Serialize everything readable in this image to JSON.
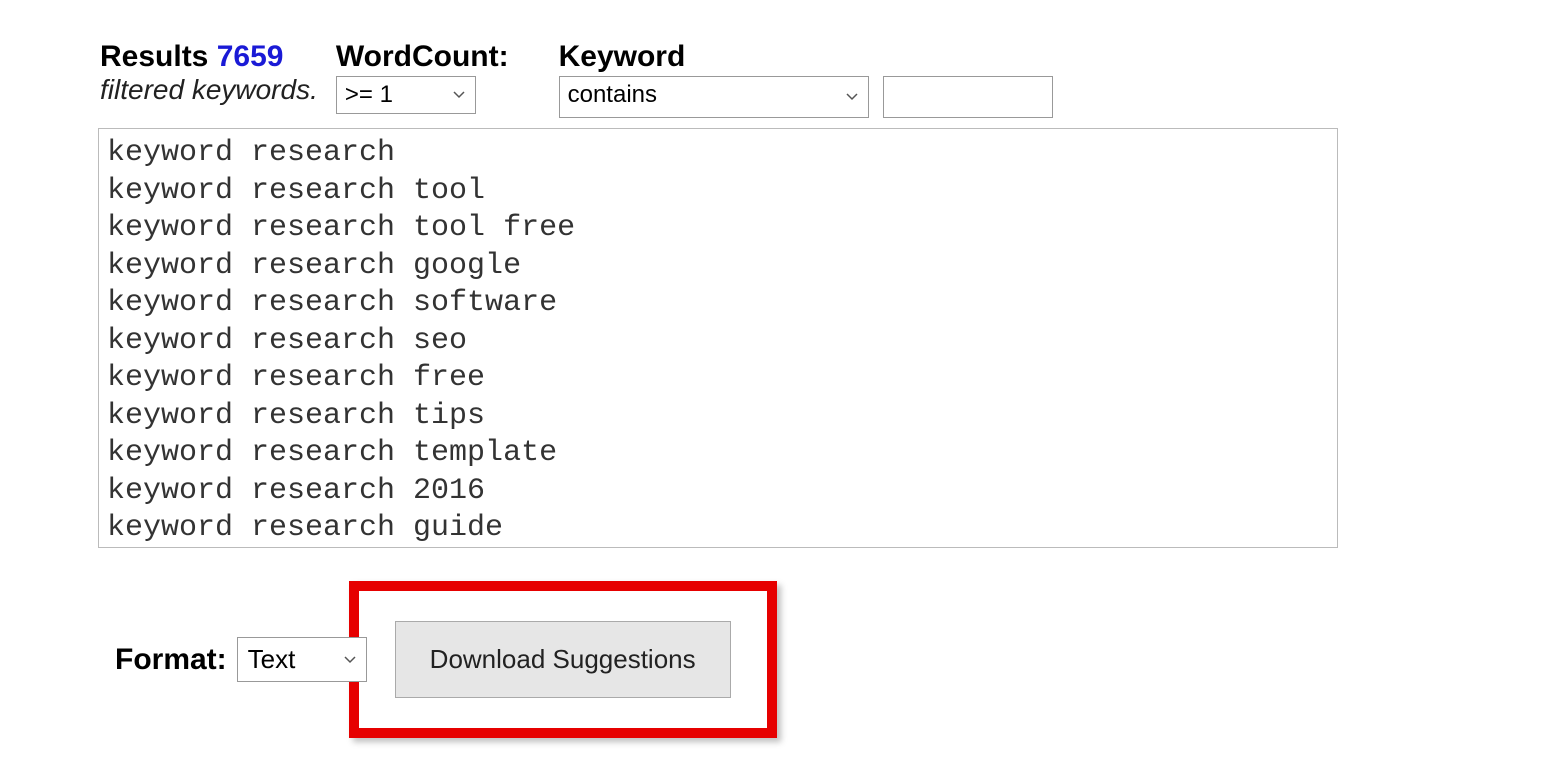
{
  "filters": {
    "results_label": "Results",
    "results_count": "7659",
    "filtered_label": "filtered keywords.",
    "wordcount_label": "WordCount:",
    "wordcount_value": ">= 1",
    "keyword_label": "Keyword",
    "keyword_operator": "contains",
    "keyword_value": ""
  },
  "results_text": "keyword research\nkeyword research tool\nkeyword research tool free\nkeyword research google\nkeyword research software\nkeyword research seo\nkeyword research free\nkeyword research tips\nkeyword research template\nkeyword research 2016\nkeyword research guide",
  "bottom": {
    "format_label": "Format:",
    "format_value": "Text",
    "download_label": "Download Suggestions"
  }
}
